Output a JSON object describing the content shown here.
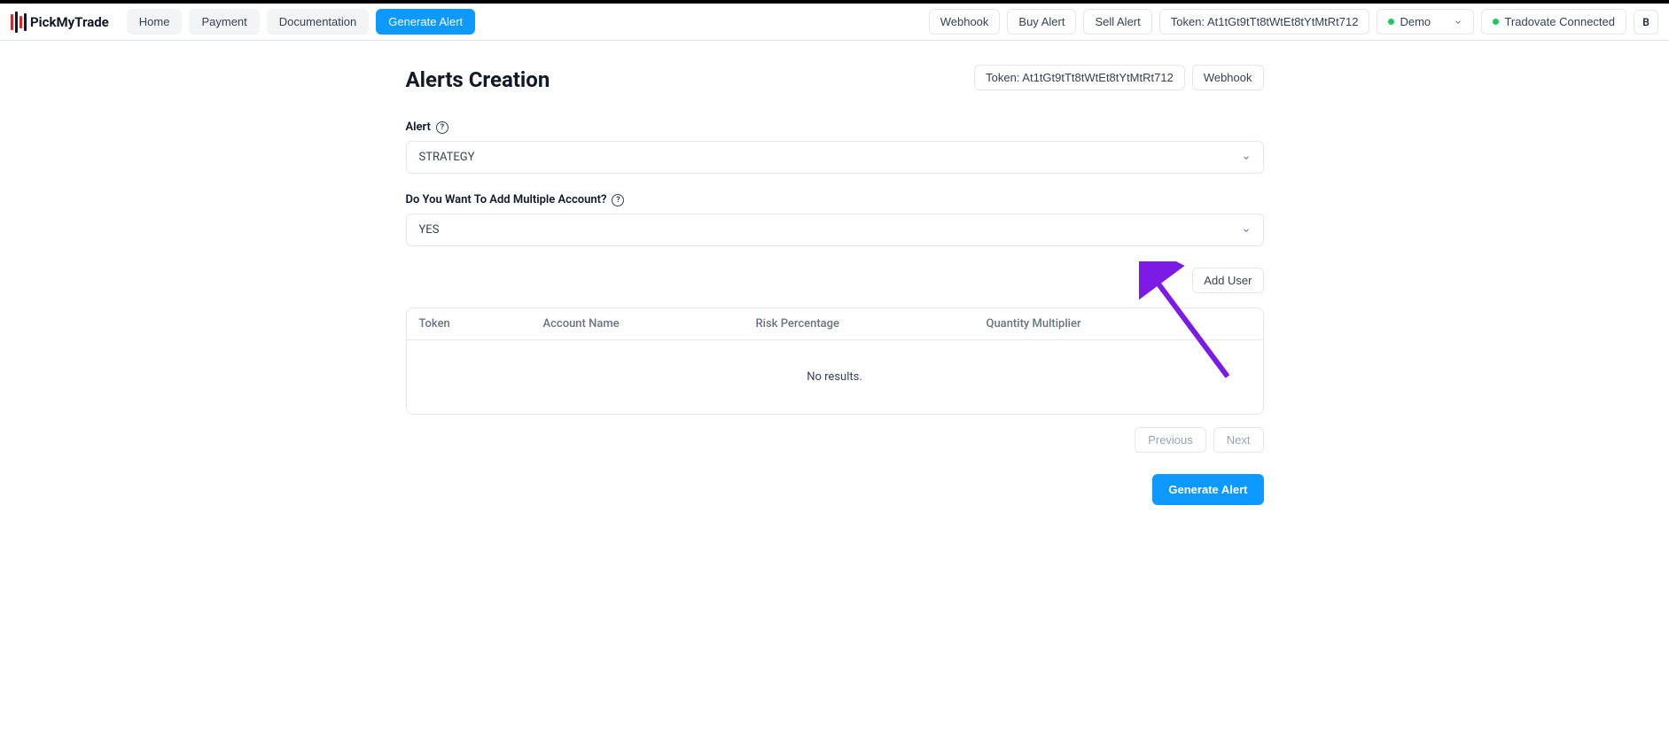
{
  "brand": "PickMyTrade",
  "nav": {
    "home": "Home",
    "payment": "Payment",
    "documentation": "Documentation",
    "generate_alert": "Generate Alert"
  },
  "header_right": {
    "webhook": "Webhook",
    "buy_alert": "Buy Alert",
    "sell_alert": "Sell Alert",
    "token": "Token: At1tGt9tTt8tWtEt8tYtMtRt712",
    "demo": "Demo",
    "connection": "Tradovate Connected",
    "avatar": "B"
  },
  "page": {
    "title": "Alerts Creation",
    "token_btn": "Token: At1tGt9tTt8tWtEt8tYtMtRt712",
    "webhook_btn": "Webhook"
  },
  "form": {
    "alert_label": "Alert",
    "alert_value": "STRATEGY",
    "multi_label": "Do You Want To Add Multiple Account?",
    "multi_value": "YES",
    "add_user": "Add User"
  },
  "table": {
    "col_token": "Token",
    "col_account": "Account Name",
    "col_risk": "Risk Percentage",
    "col_qty": "Quantity Multiplier",
    "empty": "No results."
  },
  "pagination": {
    "prev": "Previous",
    "next": "Next"
  },
  "actions": {
    "generate": "Generate Alert"
  }
}
